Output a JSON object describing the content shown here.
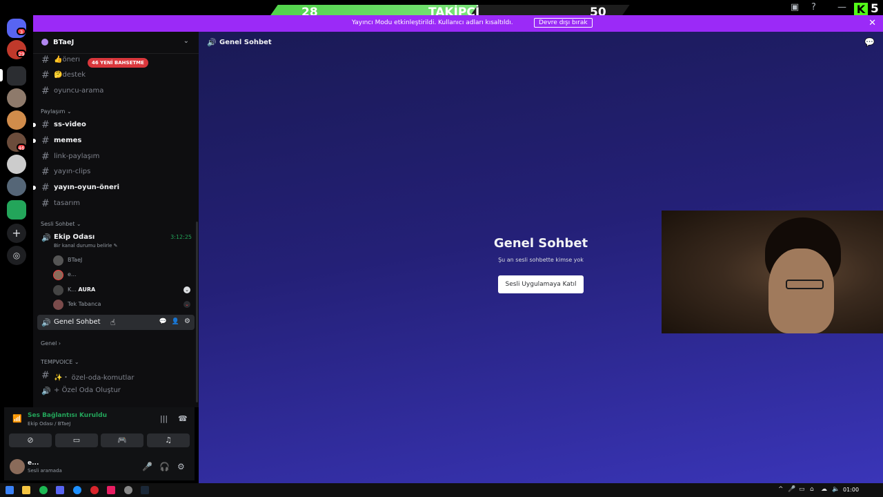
{
  "overlay": {
    "left_number": "28",
    "label": "TAKİPÇİ",
    "right_number": "50",
    "kick_letter": "K",
    "kick_number": "5"
  },
  "banner": {
    "text": "Yayıncı Modu etkinleştirildi. Kullanıcı adları kısaltıldı.",
    "button": "Devre dışı bırak"
  },
  "server_rail": {
    "dm_badge": "3",
    "badge_2": "29",
    "badge_3": "46"
  },
  "server": {
    "name": "BTaeJ"
  },
  "mention_pill": "46 YENİ BAHSETME",
  "channels_top": [
    {
      "name": "önerı",
      "prefix": "👍"
    },
    {
      "name": "destek",
      "prefix": "🤔"
    },
    {
      "name": "oyuncu-arama",
      "prefix": ""
    }
  ],
  "category_share": "Paylaşım",
  "channels_share": [
    {
      "name": "ss-video",
      "unread": true
    },
    {
      "name": "memes",
      "unread": true
    },
    {
      "name": "link-paylaşım",
      "unread": false
    },
    {
      "name": "yayın-clips",
      "unread": false
    },
    {
      "name": "yayın-oyun-öneri",
      "unread": true
    },
    {
      "name": "tasarım",
      "unread": false
    }
  ],
  "category_voice": "Sesli Sohbet",
  "voice_channel": {
    "name": "Ekip Odası",
    "timer": "3:12:25",
    "status_hint": "Bir kanal durumu belirle",
    "users": [
      "BTaeJ",
      "e...",
      "K...",
      "Tek Tabanca"
    ],
    "aura_tag": "AURA"
  },
  "genel_sohbet": "Genel Sohbet",
  "category_genel": "Genel",
  "category_tempvoice": "TEMPVOICE",
  "tempvoice_channels": [
    {
      "name": "özel-oda-komutlar",
      "prefix": "✨・"
    },
    {
      "name": "Özel Oda Oluştur",
      "prefix": "+"
    }
  ],
  "voice_panel": {
    "status": "Ses Bağlantısı Kuruldu",
    "sub": "Ekip Odası / BTaeJ"
  },
  "user_panel": {
    "name": "e...",
    "status": "Sesli aramada"
  },
  "main": {
    "header_title": "Genel Sohbet",
    "empty_title": "Genel Sohbet",
    "empty_sub": "Şu an sesli sohbette kimse yok",
    "join_button": "Sesli Uygulamaya Katıl"
  },
  "taskbar": {
    "clock": "01:00"
  }
}
